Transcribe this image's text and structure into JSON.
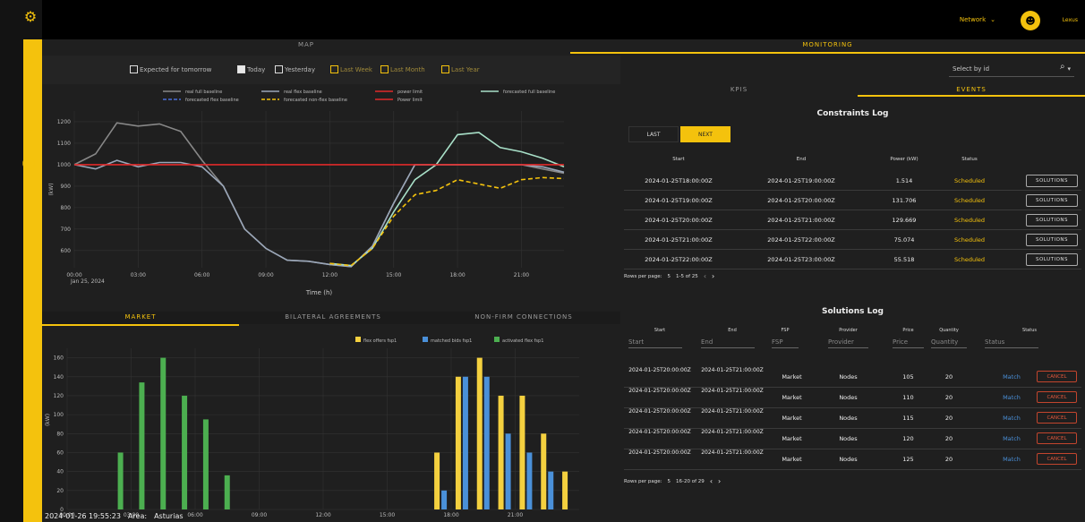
{
  "header": {
    "network_label": "Network",
    "user_label": "Lexus"
  },
  "nav": {
    "map_tab": "MAP",
    "monitoring_tab": "MONITORING"
  },
  "filters": {
    "items": [
      {
        "label": "Expected for tomorrow",
        "checked": false,
        "color": "#ffffff"
      },
      {
        "label": "Today",
        "checked": true,
        "color": "#ffffff"
      },
      {
        "label": "Yesterday",
        "checked": false,
        "color": "#ffffff"
      },
      {
        "label": "Last Week",
        "checked": false,
        "color": "#f4c20d"
      },
      {
        "label": "Last Month",
        "checked": false,
        "color": "#f4c20d"
      },
      {
        "label": "Last Year",
        "checked": false,
        "color": "#f4c20d"
      }
    ]
  },
  "select": {
    "placeholder": "Select by id"
  },
  "subtabs": {
    "kpis": "KPIS",
    "events": "EVENTS"
  },
  "bottom_tabs": {
    "market": "MARKET",
    "bilateral": "BILATERAL AGREEMENTS",
    "nonfirm": "NON-FIRM CONNECTIONS"
  },
  "footer": {
    "timestamp": "2024-01-26 19:55:23",
    "area_label": "Area:",
    "area_value": "Asturias"
  },
  "constraints": {
    "title": "Constraints Log",
    "last_label": "LAST",
    "next_label": "NEXT",
    "headers": [
      "Start",
      "End",
      "Power (kW)",
      "Status"
    ],
    "rows": [
      {
        "start": "2024-01-25T18:00:00Z",
        "end": "2024-01-25T19:00:00Z",
        "power": "1.514",
        "status": "Scheduled",
        "action": "SOLUTIONS"
      },
      {
        "start": "2024-01-25T19:00:00Z",
        "end": "2024-01-25T20:00:00Z",
        "power": "131.706",
        "status": "Scheduled",
        "action": "SOLUTIONS"
      },
      {
        "start": "2024-01-25T20:00:00Z",
        "end": "2024-01-25T21:00:00Z",
        "power": "129.669",
        "status": "Scheduled",
        "action": "SOLUTIONS"
      },
      {
        "start": "2024-01-25T21:00:00Z",
        "end": "2024-01-25T22:00:00Z",
        "power": "75.074",
        "status": "Scheduled",
        "action": "SOLUTIONS"
      },
      {
        "start": "2024-01-25T22:00:00Z",
        "end": "2024-01-25T23:00:00Z",
        "power": "55.518",
        "status": "Scheduled",
        "action": "SOLUTIONS"
      }
    ],
    "pager": {
      "rows_label": "Rows per page:",
      "rows_value": "5",
      "range": "1-5 of 25"
    }
  },
  "solutions": {
    "title": "Solutions Log",
    "headers": [
      "Start",
      "End",
      "FSP",
      "Provider",
      "Price",
      "Quantity",
      "Status"
    ],
    "filters": [
      "Start",
      "End",
      "FSP",
      "Provider",
      "Price",
      "Quantity",
      "Status"
    ],
    "rows": [
      {
        "start": "2024-01-25T20:00:00Z",
        "end": "2024-01-25T21:00:00Z",
        "fsp": "Market",
        "provider": "Nodes",
        "price": "105",
        "quantity": "20",
        "match": "Match",
        "cancel": "CANCEL"
      },
      {
        "start": "2024-01-25T20:00:00Z",
        "end": "2024-01-25T21:00:00Z",
        "fsp": "Market",
        "provider": "Nodes",
        "price": "110",
        "quantity": "20",
        "match": "Match",
        "cancel": "CANCEL"
      },
      {
        "start": "2024-01-25T20:00:00Z",
        "end": "2024-01-25T21:00:00Z",
        "fsp": "Market",
        "provider": "Nodes",
        "price": "115",
        "quantity": "20",
        "match": "Match",
        "cancel": "CANCEL"
      },
      {
        "start": "2024-01-25T20:00:00Z",
        "end": "2024-01-25T21:00:00Z",
        "fsp": "Market",
        "provider": "Nodes",
        "price": "120",
        "quantity": "20",
        "match": "Match",
        "cancel": "CANCEL"
      },
      {
        "start": "2024-01-25T20:00:00Z",
        "end": "2024-01-25T21:00:00Z",
        "fsp": "Market",
        "provider": "Nodes",
        "price": "125",
        "quantity": "20",
        "match": "Match",
        "cancel": "CANCEL"
      }
    ],
    "pager": {
      "rows_label": "Rows per page:",
      "rows_value": "5",
      "range": "16-20 of 29"
    }
  },
  "chart_data": [
    {
      "type": "line",
      "xlabel": "Time (h)",
      "ylabel": "(kW)",
      "date_label": "Jan 25, 2024",
      "x": [
        "00:00",
        "01:00",
        "02:00",
        "03:00",
        "04:00",
        "05:00",
        "06:00",
        "07:00",
        "08:00",
        "09:00",
        "10:00",
        "11:00",
        "12:00",
        "13:00",
        "14:00",
        "15:00",
        "16:00",
        "17:00",
        "18:00",
        "19:00",
        "20:00",
        "21:00",
        "22:00",
        "23:00"
      ],
      "xticks": [
        "00:00",
        "03:00",
        "06:00",
        "09:00",
        "12:00",
        "15:00",
        "18:00",
        "21:00"
      ],
      "yticks": [
        600,
        700,
        800,
        900,
        1000,
        1100,
        1200
      ],
      "ylim": [
        520,
        1250
      ],
      "legend": [
        "real full baseline",
        "real flex baseline",
        "power limit",
        "forecasted full baseline",
        "forecasted flex baseline",
        "forecasted non-flex baseline",
        "Power limit"
      ],
      "series": [
        {
          "name": "real full baseline",
          "color": "#888888",
          "values": [
            1000,
            1050,
            1195,
            1180,
            1190,
            1155,
            1020,
            900,
            700,
            610,
            555,
            550,
            535,
            525,
            620,
            820,
            1000,
            1000,
            1000,
            1000,
            1000,
            1000,
            980,
            960
          ]
        },
        {
          "name": "real flex baseline",
          "color": "#9aa6b8",
          "values": [
            1000,
            980,
            1020,
            990,
            1010,
            1010,
            990,
            900,
            700,
            610,
            555,
            550,
            535,
            525,
            620,
            820,
            1000,
            1000,
            1000,
            1000,
            1000,
            1000,
            990,
            965
          ]
        },
        {
          "name": "forecasted full baseline",
          "color": "#a8e0c8",
          "values": [
            null,
            null,
            null,
            null,
            null,
            null,
            null,
            null,
            null,
            null,
            null,
            null,
            540,
            530,
            610,
            780,
            930,
            1000,
            1140,
            1150,
            1080,
            1060,
            1030,
            990
          ]
        },
        {
          "name": "forecasted non-flex baseline",
          "color": "#f4c20d",
          "dash": true,
          "values": [
            null,
            null,
            null,
            null,
            null,
            null,
            null,
            null,
            null,
            null,
            null,
            null,
            540,
            530,
            610,
            760,
            860,
            880,
            930,
            910,
            890,
            930,
            940,
            935
          ]
        },
        {
          "name": "power limit",
          "color": "#e02a2a",
          "values": [
            1000,
            1000,
            1000,
            1000,
            1000,
            1000,
            1000,
            1000,
            1000,
            1000,
            1000,
            1000,
            1000,
            1000,
            1000,
            1000,
            1000,
            1000,
            1000,
            1000,
            1000,
            1000,
            1000,
            1000
          ]
        }
      ]
    },
    {
      "type": "bar",
      "ylabel": "(kW)",
      "legend": [
        "flex offers fsp1",
        "matched bids fsp1",
        "activated flex fsp1"
      ],
      "x": [
        "00:00",
        "01:00",
        "02:00",
        "03:00",
        "04:00",
        "05:00",
        "06:00",
        "07:00",
        "08:00",
        "09:00",
        "10:00",
        "11:00",
        "12:00",
        "13:00",
        "14:00",
        "15:00",
        "16:00",
        "17:00",
        "18:00",
        "19:00",
        "20:00",
        "21:00",
        "22:00",
        "23:00"
      ],
      "xticks": [
        "00:00",
        "03:00",
        "06:00",
        "09:00",
        "12:00",
        "15:00",
        "18:00",
        "21:00"
      ],
      "yticks": [
        0,
        20,
        40,
        60,
        80,
        100,
        120,
        140,
        160
      ],
      "ylim": [
        0,
        170
      ],
      "series": [
        {
          "name": "flex offers fsp1",
          "color": "#f4d03f",
          "values": [
            0,
            0,
            0,
            0,
            0,
            0,
            0,
            0,
            0,
            0,
            0,
            0,
            0,
            0,
            0,
            0,
            0,
            60,
            140,
            160,
            120,
            120,
            80,
            40
          ]
        },
        {
          "name": "matched bids fsp1",
          "color": "#4a90d9",
          "values": [
            0,
            0,
            0,
            0,
            0,
            0,
            0,
            0,
            0,
            0,
            0,
            0,
            0,
            0,
            0,
            0,
            0,
            20,
            140,
            140,
            80,
            60,
            40,
            0
          ]
        },
        {
          "name": "activated flex fsp1",
          "color": "#4caf50",
          "values": [
            0,
            0,
            60,
            134,
            160,
            120,
            95,
            36,
            0,
            0,
            0,
            0,
            0,
            0,
            0,
            0,
            0,
            0,
            0,
            0,
            0,
            0,
            0,
            0
          ]
        }
      ]
    }
  ]
}
